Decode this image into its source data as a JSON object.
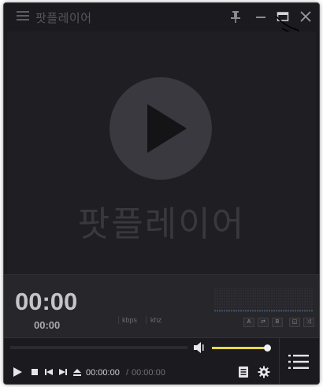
{
  "titlebar": {
    "title": "팟플레이어",
    "icons": [
      "menu-icon",
      "pin-icon",
      "minimize-icon",
      "maximize-icon",
      "close-icon"
    ]
  },
  "video": {
    "watermark": "팟플레이어",
    "play_icon": "play-icon"
  },
  "info": {
    "time_big": "00:00",
    "time_small": "00:00",
    "bitrate_unit": "kbps",
    "samplerate_unit": "khz",
    "mini_buttons": [
      "A",
      "⇄",
      "B",
      "◱",
      "⤨"
    ]
  },
  "controls": {
    "current_time": "00:00:00",
    "separator": "/",
    "total_time": "00:00:00",
    "volume_level": 0.95,
    "seek_progress": 0,
    "icons": [
      "play-icon",
      "stop-icon",
      "previous-icon",
      "next-icon",
      "eject-icon",
      "volume-icon",
      "playlist-doc-icon",
      "gear-icon",
      "playlist-icon"
    ]
  },
  "colors": {
    "background": "#1b1b1f",
    "panel": "#26262b",
    "accent_volume": "#e8d94a",
    "spectrum_line": "#5a7fa3",
    "text_primary": "#c4c4ca"
  }
}
